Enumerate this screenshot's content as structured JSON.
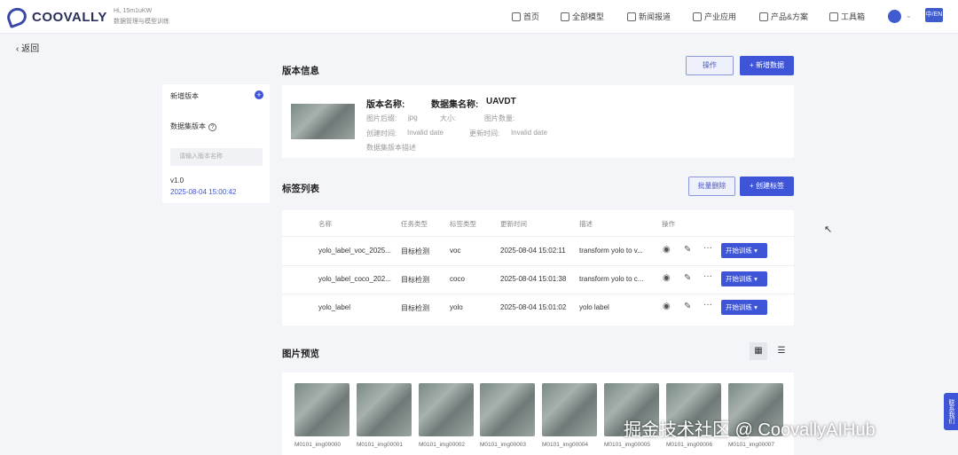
{
  "header": {
    "brand": "COOVALLY",
    "greeting_line1": "Hi, 15m1uKW",
    "greeting_line2": "数据管理与模型训练",
    "nav": [
      {
        "label": "首页",
        "icon": "home-icon"
      },
      {
        "label": "全部模型",
        "icon": "cube-icon"
      },
      {
        "label": "新闻报道",
        "icon": "newspaper-icon"
      },
      {
        "label": "产业应用",
        "icon": "industry-icon"
      },
      {
        "label": "产品&方案",
        "icon": "bulb-icon"
      },
      {
        "label": "工具箱",
        "icon": "toolbox-icon"
      }
    ],
    "lang": "中/EN"
  },
  "back": {
    "label": "返回"
  },
  "sidebar": {
    "add_version": "新增版本",
    "dataset_version": "数据集版本",
    "search_placeholder": "请输入版本名称",
    "version": "v1.0",
    "version_date": "2025-08-04 15:00:42"
  },
  "version_info": {
    "title": "版本信息",
    "action_btn": "操作",
    "add_data_btn": "+ 新增数据",
    "version_name_label": "版本名称:",
    "dataset_name_label": "数据集名称:",
    "dataset_name": "UAVDT",
    "format_label": "图片后缀:",
    "format_value": "jpg",
    "size_label": "大小:",
    "count_label": "图片数量:",
    "created_label": "创建时间:",
    "created_value": "Invalid date",
    "updated_label": "更新时间:",
    "updated_value": "Invalid date",
    "description": "数据集版本描述"
  },
  "label_list": {
    "title": "标签列表",
    "batch_delete_btn": "批量删除",
    "create_btn": "+ 创建标签",
    "columns": [
      "名称",
      "任务类型",
      "标签类型",
      "更新时间",
      "描述",
      "操作"
    ],
    "rows": [
      {
        "name": "yolo_label_voc_2025...",
        "task": "目标检测",
        "type": "voc",
        "time": "2025-08-04 15:02:11",
        "desc": "transform yolo to v...",
        "train": "开始训练"
      },
      {
        "name": "yolo_label_coco_202...",
        "task": "目标检测",
        "type": "coco",
        "time": "2025-08-04 15:01:38",
        "desc": "transform yolo to c...",
        "train": "开始训练"
      },
      {
        "name": "yolo_label",
        "task": "目标检测",
        "type": "yolo",
        "time": "2025-08-04 15:01:02",
        "desc": "yolo label",
        "train": "开始训练"
      }
    ]
  },
  "preview": {
    "title": "图片预览",
    "images": [
      "M0101_img00000",
      "M0101_img00001",
      "M0101_img00002",
      "M0101_img00003",
      "M0101_img00004",
      "M0101_img00005",
      "M0101_img00006",
      "M0101_img00007"
    ]
  },
  "side_tab": "联系我们",
  "watermark": "掘金技术社区 @ CoovallyAIHub",
  "colors": {
    "primary": "#3f55d8",
    "brand": "#2b2f5a"
  }
}
